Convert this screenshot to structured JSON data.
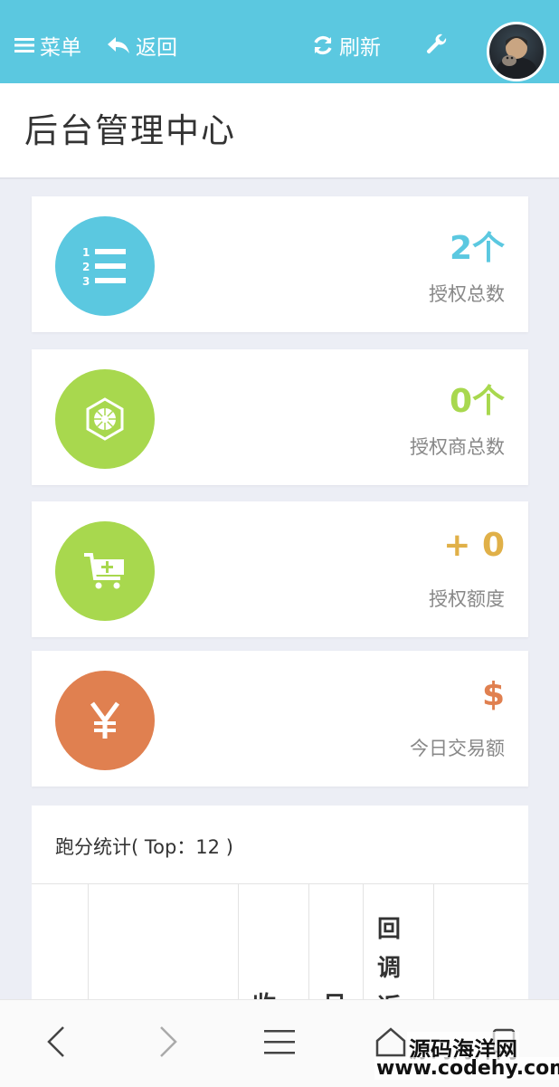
{
  "topbar": {
    "menu_label": "菜单",
    "back_label": "返回",
    "refresh_label": "刷新"
  },
  "page": {
    "title": "后台管理中心"
  },
  "stats": [
    {
      "value": "2个",
      "label": "授权总数",
      "color": "#5bc8e0",
      "icon": "list-numbered-icon"
    },
    {
      "value": "0个",
      "label": "授权商总数",
      "color": "#a8d84e",
      "icon": "snowflake-badge-icon"
    },
    {
      "value": "+ 0",
      "label": "授权额度",
      "color": "#e0b048",
      "circle_color": "#a8d84e",
      "icon": "cart-plus-icon"
    },
    {
      "value": "$",
      "label": "今日交易额",
      "color": "#e08050",
      "icon": "yen-icon"
    }
  ],
  "ranking": {
    "title": "跑分统计( Top：12 )",
    "col_fragments": [
      "收",
      "日",
      "回调返"
    ]
  },
  "watermark": {
    "line1": "源码海洋网",
    "line2": "www.codehy.com"
  }
}
